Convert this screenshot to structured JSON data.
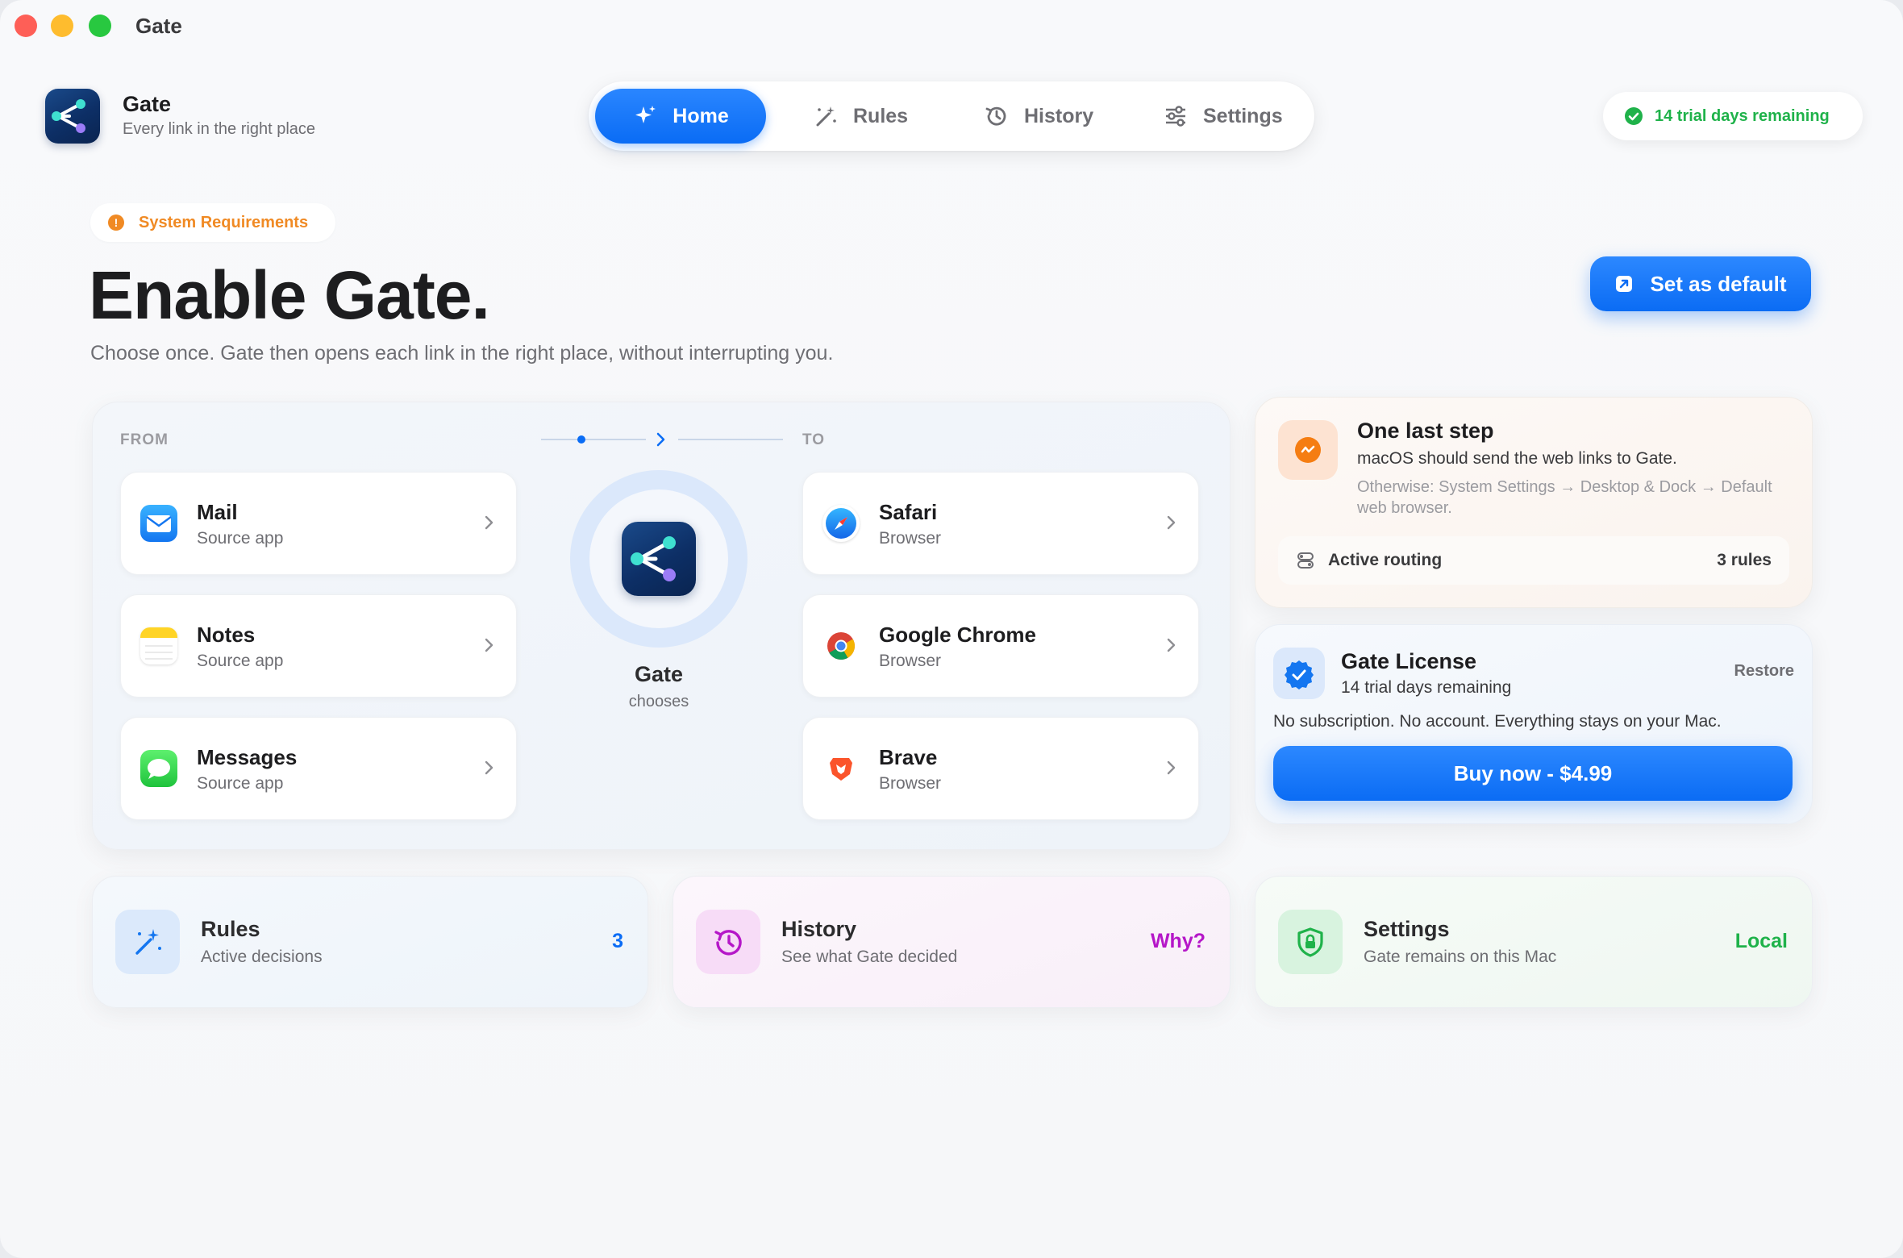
{
  "window": {
    "title": "Gate"
  },
  "brand": {
    "name": "Gate",
    "tagline": "Every link in the right place"
  },
  "nav": {
    "items": [
      {
        "label": "Home",
        "icon": "sparkles-icon",
        "active": true
      },
      {
        "label": "Rules",
        "icon": "magic-wand-icon",
        "active": false
      },
      {
        "label": "History",
        "icon": "history-clock-icon",
        "active": false
      },
      {
        "label": "Settings",
        "icon": "sliders-icon",
        "active": false
      }
    ]
  },
  "trial_badge": {
    "text": "14 trial days remaining",
    "icon": "check-circle-icon"
  },
  "hero": {
    "badge": "System Requirements",
    "badge_icon": "!",
    "title": "Enable Gate.",
    "subtitle": "Choose once. Gate then opens each link in the right place, without interrupting you.",
    "cta": "Set as default"
  },
  "flow": {
    "from_label": "FROM",
    "to_label": "TO",
    "sources": [
      {
        "name": "Mail",
        "sub": "Source app",
        "icon": "mail-icon"
      },
      {
        "name": "Notes",
        "sub": "Source app",
        "icon": "notes-icon"
      },
      {
        "name": "Messages",
        "sub": "Source app",
        "icon": "messages-icon"
      }
    ],
    "center": {
      "name": "Gate",
      "sub": "chooses"
    },
    "targets": [
      {
        "name": "Safari",
        "sub": "Browser",
        "icon": "safari-icon"
      },
      {
        "name": "Google Chrome",
        "sub": "Browser",
        "icon": "chrome-icon"
      },
      {
        "name": "Brave",
        "sub": "Browser",
        "icon": "brave-icon"
      }
    ]
  },
  "last_step": {
    "title": "One last step",
    "body": "macOS should send the web links to Gate.",
    "note": "Otherwise: System Settings → Desktop & Dock → Default web browser.",
    "routing_label": "Active routing",
    "routing_count": "3 rules"
  },
  "license": {
    "title": "Gate License",
    "sub": "14 trial days remaining",
    "restore": "Restore",
    "note": "No subscription. No account. Everything stays on your Mac.",
    "buy": "Buy now - $4.99"
  },
  "bottom": {
    "rules": {
      "title": "Rules",
      "sub": "Active decisions",
      "value": "3"
    },
    "history": {
      "title": "History",
      "sub": "See what Gate decided",
      "value": "Why?"
    },
    "settings": {
      "title": "Settings",
      "sub": "Gate remains on this Mac",
      "value": "Local"
    }
  },
  "colors": {
    "accent": "#0a6cf5",
    "success": "#1fb24a",
    "warning": "#f08a24",
    "history_accent": "#b517c8"
  }
}
